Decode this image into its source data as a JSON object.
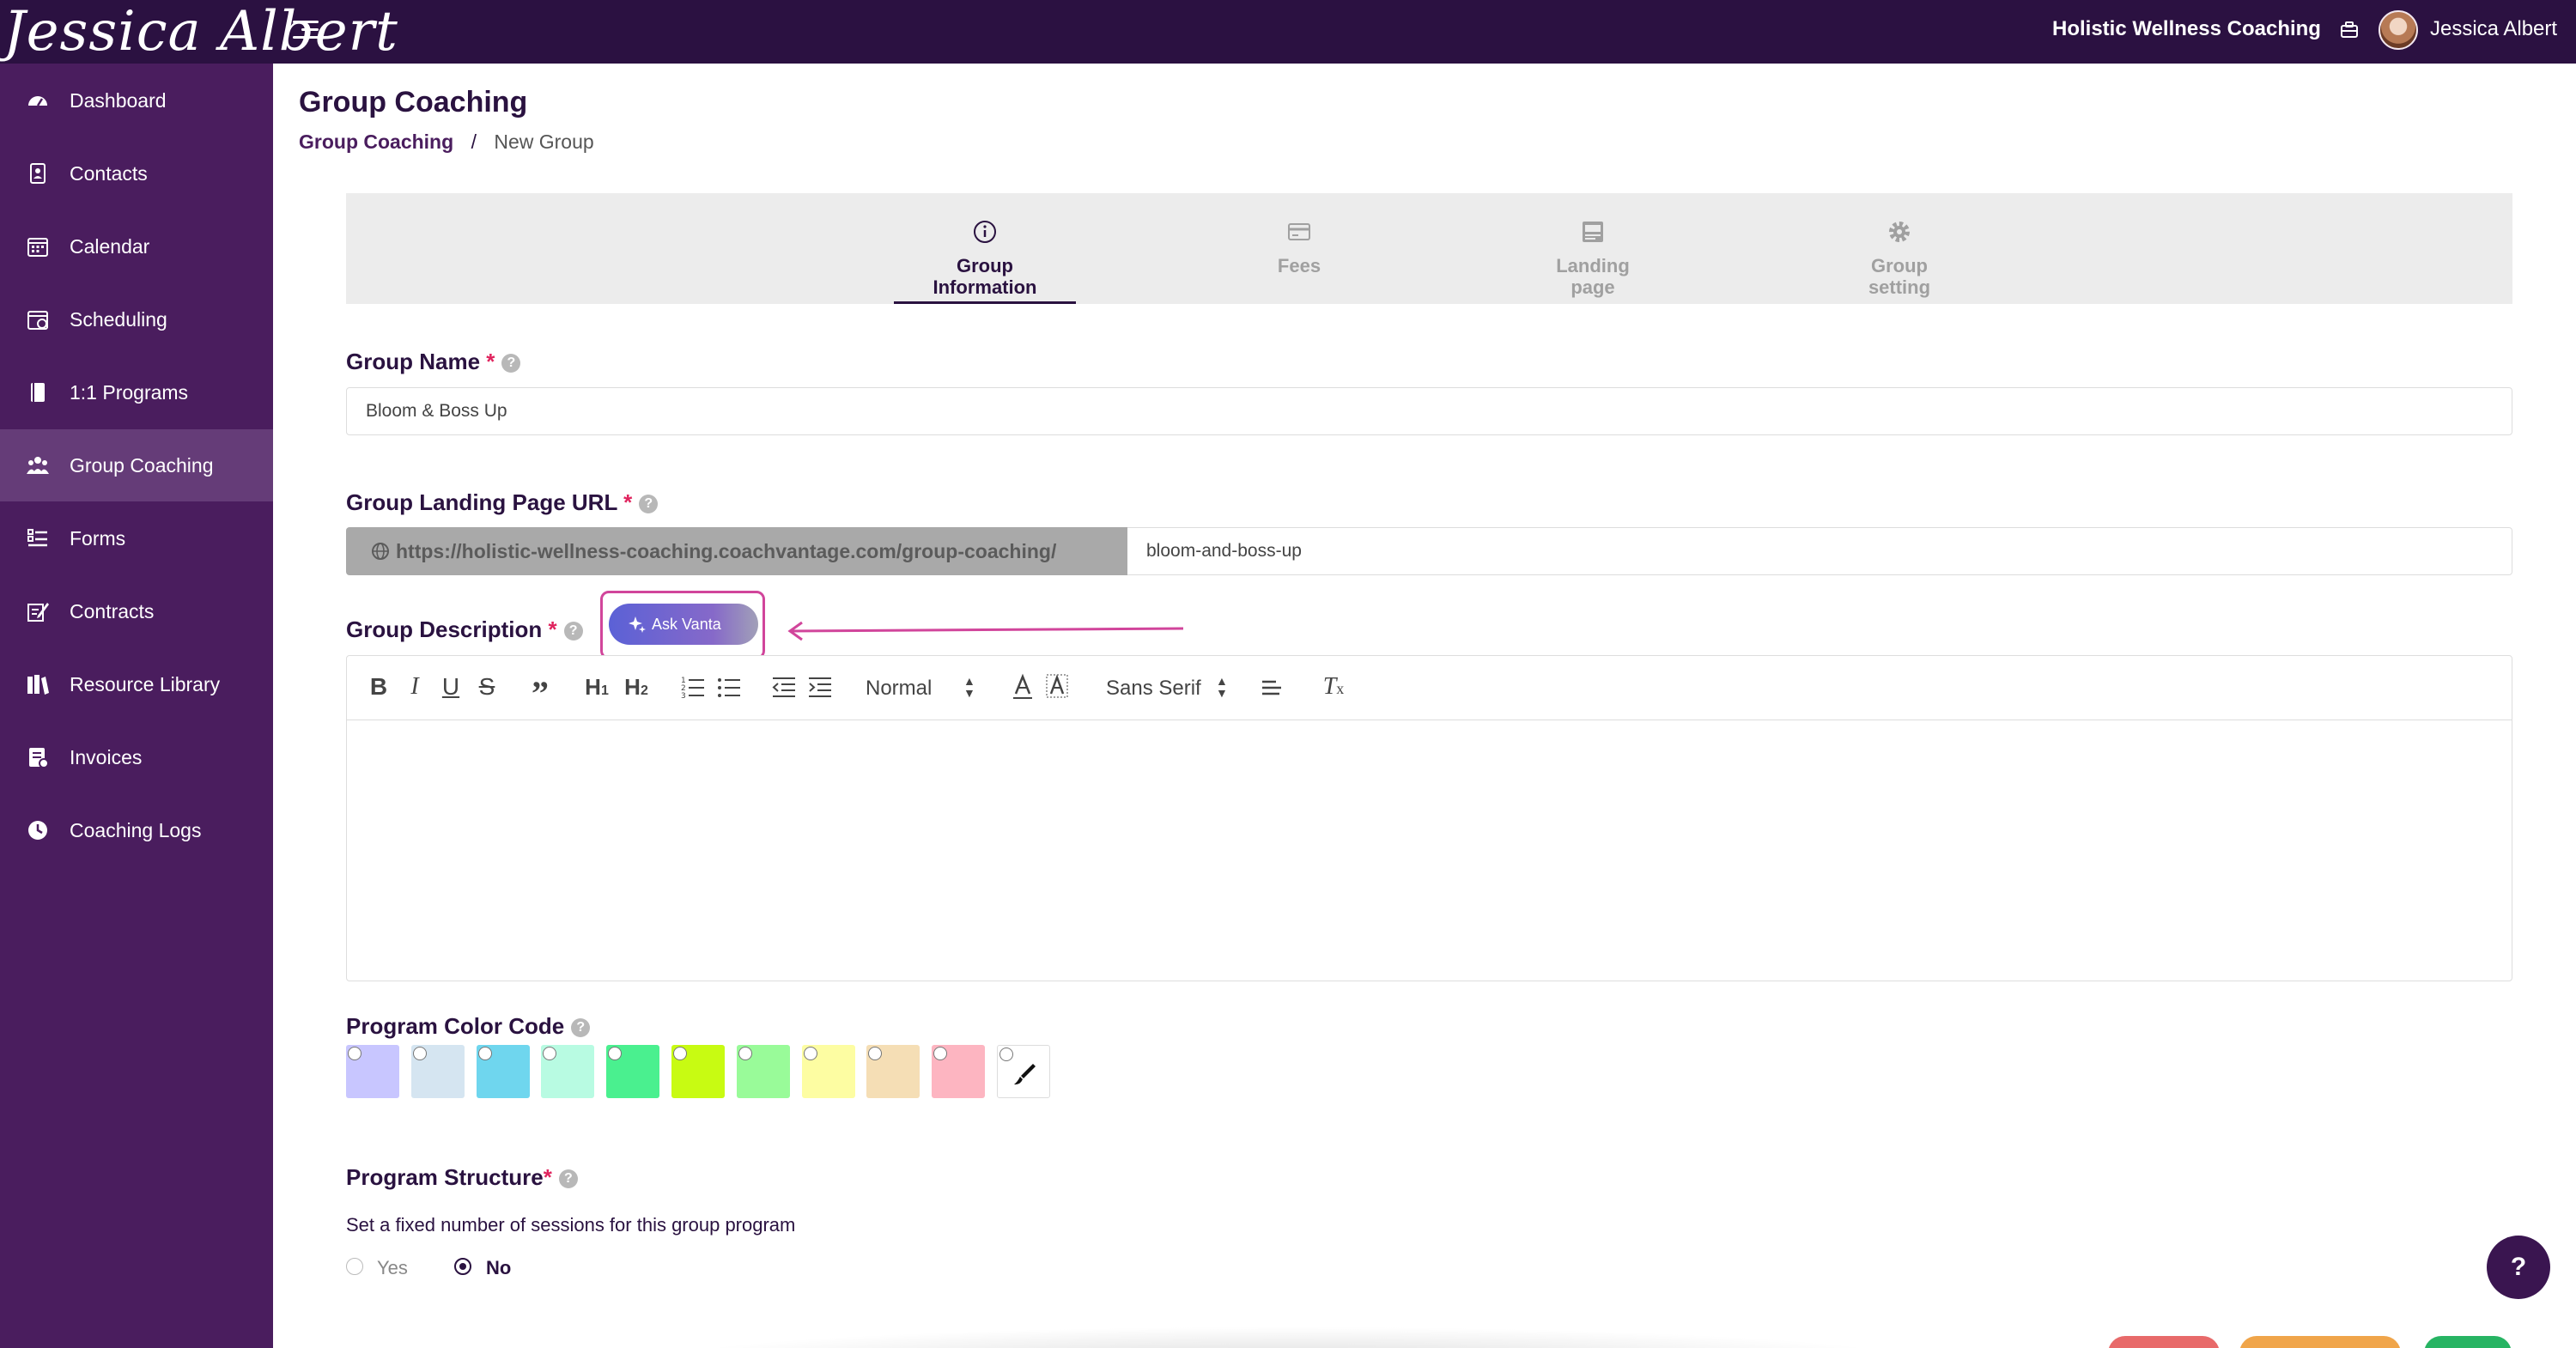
{
  "header": {
    "logo_text": "Jessica Albert",
    "business_name": "Holistic Wellness Coaching",
    "user_name": "Jessica Albert"
  },
  "sidebar": {
    "items": [
      {
        "label": "Dashboard",
        "icon": "dashboard-icon",
        "active": false
      },
      {
        "label": "Contacts",
        "icon": "contacts-icon",
        "active": false
      },
      {
        "label": "Calendar",
        "icon": "calendar-icon",
        "active": false
      },
      {
        "label": "Scheduling",
        "icon": "scheduling-icon",
        "active": false
      },
      {
        "label": "1:1 Programs",
        "icon": "book-icon",
        "active": false
      },
      {
        "label": "Group Coaching",
        "icon": "group-icon",
        "active": true
      },
      {
        "label": "Forms",
        "icon": "forms-icon",
        "active": false
      },
      {
        "label": "Contracts",
        "icon": "contract-icon",
        "active": false
      },
      {
        "label": "Resource Library",
        "icon": "library-icon",
        "active": false
      },
      {
        "label": "Invoices",
        "icon": "invoice-icon",
        "active": false
      },
      {
        "label": "Coaching Logs",
        "icon": "clock-icon",
        "active": false
      }
    ]
  },
  "page": {
    "title": "Group Coaching",
    "breadcrumb": {
      "parent": "Group Coaching",
      "separator": "/",
      "current": "New Group"
    }
  },
  "steps": [
    {
      "line1": "Group",
      "line2": "Information",
      "icon": "info-icon",
      "active": true
    },
    {
      "line1": "Fees",
      "line2": "",
      "icon": "card-icon",
      "active": false
    },
    {
      "line1": "Landing",
      "line2": "page",
      "icon": "landing-icon",
      "active": false
    },
    {
      "line1": "Group",
      "line2": "setting",
      "icon": "gear-icon",
      "active": false
    }
  ],
  "form": {
    "group_name": {
      "label": "Group Name",
      "required_mark": "*",
      "value": "Bloom & Boss Up"
    },
    "landing_url": {
      "label": "Group Landing Page URL",
      "required_mark": "*",
      "prefix": "https://holistic-wellness-coaching.coachvantage.com/group-coaching/",
      "slug": "bloom-and-boss-up"
    },
    "description": {
      "label": "Group Description",
      "required_mark": "*",
      "ask_button": "Ask Vanta",
      "toolbar": {
        "header_select": "Normal",
        "font_select": "Sans Serif"
      }
    },
    "color_code": {
      "label": "Program Color Code",
      "colors": [
        "#c8c6ff",
        "#d5e5f1",
        "#6fd6ee",
        "#b8fbe2",
        "#4af08f",
        "#c8fb12",
        "#99fb99",
        "#fdfda2",
        "#f5deb5",
        "#fdb5c1"
      ]
    },
    "structure": {
      "label": "Program Structure",
      "required_mark": "*",
      "hint": "Set a fixed number of sessions for this group program",
      "options": [
        {
          "label": "Yes",
          "checked": false
        },
        {
          "label": "No",
          "checked": true
        }
      ]
    }
  },
  "help_fab": "?",
  "colors": {
    "topbar": "#2b1141",
    "sidebar": "#4a1d5e",
    "sidebar_active": "#653c78",
    "accent": "#2a1240",
    "highlight": "#d1459b"
  },
  "footer_buttons": [
    "#e86a6a",
    "#f0a54a",
    "#27b463"
  ]
}
